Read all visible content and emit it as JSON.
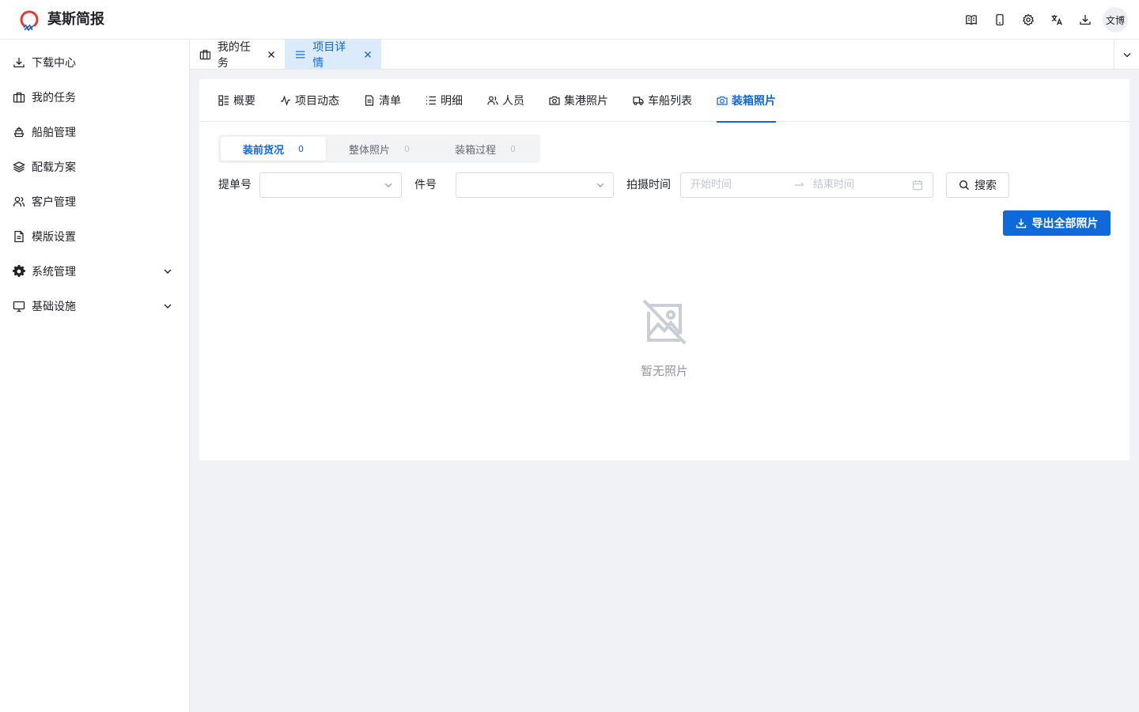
{
  "app": {
    "brand": "莫斯简报",
    "user_avatar": "文博",
    "accent": "#1266d6"
  },
  "header_icons": [
    "book-icon",
    "mobile-icon",
    "gear-icon",
    "translate-icon",
    "download-icon"
  ],
  "sidebar": {
    "items": [
      {
        "label": "下载中心",
        "icon": "download-icon"
      },
      {
        "label": "我的任务",
        "icon": "briefcase-icon"
      },
      {
        "label": "船舶管理",
        "icon": "ship-icon"
      },
      {
        "label": "配载方案",
        "icon": "layers-icon"
      },
      {
        "label": "客户管理",
        "icon": "users-icon"
      },
      {
        "label": "模版设置",
        "icon": "document-icon"
      },
      {
        "label": "系统管理",
        "icon": "gear-icon",
        "expandable": true
      },
      {
        "label": "基础设施",
        "icon": "monitor-icon",
        "expandable": true
      }
    ]
  },
  "page_tabs": [
    {
      "label": "我的任务",
      "icon": "briefcase-icon",
      "active": false
    },
    {
      "label": "项目详情",
      "icon": "menu-icon",
      "active": true
    }
  ],
  "content_tabs": [
    {
      "label": "概要",
      "icon": "dashboard-icon"
    },
    {
      "label": "项目动态",
      "icon": "activity-icon"
    },
    {
      "label": "清单",
      "icon": "document-icon"
    },
    {
      "label": "明细",
      "icon": "list-icon"
    },
    {
      "label": "人员",
      "icon": "users-icon"
    },
    {
      "label": "集港照片",
      "icon": "camera-icon"
    },
    {
      "label": "车船列表",
      "icon": "truck-icon"
    },
    {
      "label": "装箱照片",
      "icon": "camera-icon",
      "active": true
    }
  ],
  "photo_segments": [
    {
      "label": "装前货况",
      "count": "0",
      "active": true
    },
    {
      "label": "整体照片",
      "count": "0"
    },
    {
      "label": "装箱过程",
      "count": "0"
    }
  ],
  "filters": {
    "bill_no_label": "提单号",
    "bill_no_value": "",
    "piece_no_label": "件号",
    "piece_no_value": "",
    "shoot_time_label": "拍摄时间",
    "start_placeholder": "开始时间",
    "end_placeholder": "结束时间",
    "search_label": "搜索"
  },
  "export_label": "导出全部照片",
  "empty_text": "暂无照片"
}
